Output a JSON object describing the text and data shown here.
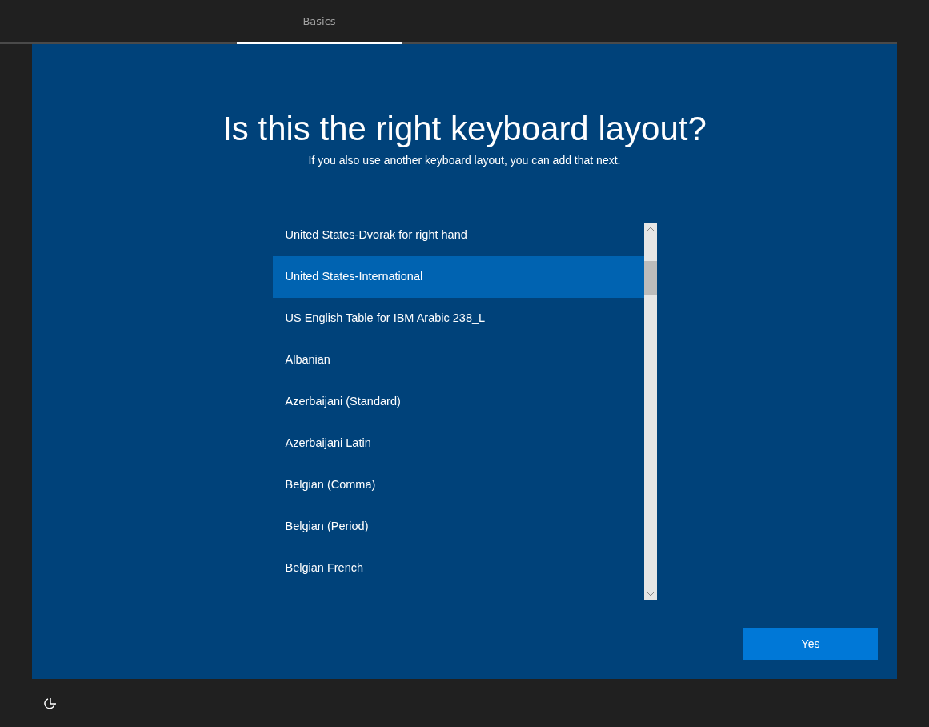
{
  "tabs": [
    {
      "label": "Basics",
      "selected": true
    }
  ],
  "title": "Is this the right keyboard layout?",
  "subtitle": "If you also use another keyboard layout, you can add that next.",
  "layouts": [
    {
      "label": "United States-Dvorak for right hand",
      "selected": false
    },
    {
      "label": "United States-International",
      "selected": true
    },
    {
      "label": "US English Table for IBM Arabic 238_L",
      "selected": false
    },
    {
      "label": "Albanian",
      "selected": false
    },
    {
      "label": "Azerbaijani (Standard)",
      "selected": false
    },
    {
      "label": "Azerbaijani Latin",
      "selected": false
    },
    {
      "label": "Belgian (Comma)",
      "selected": false
    },
    {
      "label": "Belgian (Period)",
      "selected": false
    },
    {
      "label": "Belgian French",
      "selected": false
    }
  ],
  "yes_button": "Yes"
}
